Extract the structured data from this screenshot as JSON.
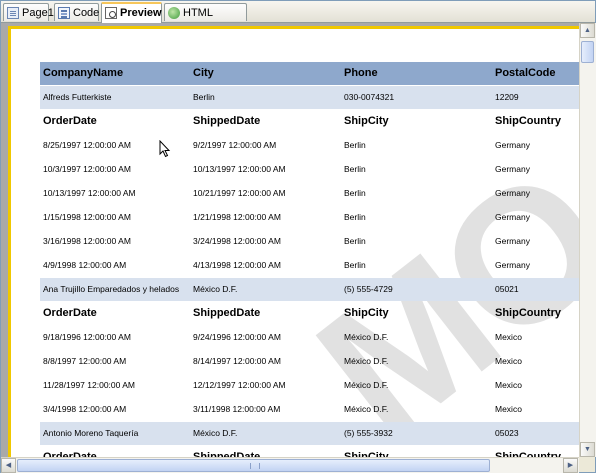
{
  "tabs": [
    {
      "label": "Page1",
      "icon": "page-icon"
    },
    {
      "label": "Code",
      "icon": "code-icon"
    },
    {
      "label": "Preview",
      "icon": "preview-icon",
      "active": true
    },
    {
      "label": "HTML Preview",
      "icon": "html-preview-icon"
    }
  ],
  "watermark": "MO",
  "header": {
    "c1": "CompanyName",
    "c2": "City",
    "c3": "Phone",
    "c4": "PostalCode"
  },
  "sub_header": {
    "c1": "OrderDate",
    "c2": "ShippedDate",
    "c3": "ShipCity",
    "c4": "ShipCountry"
  },
  "groups": [
    {
      "company": {
        "c1": "Alfreds Futterkiste",
        "c2": "Berlin",
        "c3": "030-0074321",
        "c4": "12209"
      },
      "orders": [
        {
          "c1": "8/25/1997 12:00:00 AM",
          "c2": "9/2/1997 12:00:00 AM",
          "c3": "Berlin",
          "c4": "Germany"
        },
        {
          "c1": "10/3/1997 12:00:00 AM",
          "c2": "10/13/1997 12:00:00 AM",
          "c3": "Berlin",
          "c4": "Germany"
        },
        {
          "c1": "10/13/1997 12:00:00 AM",
          "c2": "10/21/1997 12:00:00 AM",
          "c3": "Berlin",
          "c4": "Germany"
        },
        {
          "c1": "1/15/1998 12:00:00 AM",
          "c2": "1/21/1998 12:00:00 AM",
          "c3": "Berlin",
          "c4": "Germany"
        },
        {
          "c1": "3/16/1998 12:00:00 AM",
          "c2": "3/24/1998 12:00:00 AM",
          "c3": "Berlin",
          "c4": "Germany"
        },
        {
          "c1": "4/9/1998 12:00:00 AM",
          "c2": "4/13/1998 12:00:00 AM",
          "c3": "Berlin",
          "c4": "Germany"
        }
      ]
    },
    {
      "company": {
        "c1": "Ana Trujillo Emparedados y helados",
        "c2": "México D.F.",
        "c3": "(5) 555-4729",
        "c4": "05021"
      },
      "orders": [
        {
          "c1": "9/18/1996 12:00:00 AM",
          "c2": "9/24/1996 12:00:00 AM",
          "c3": "México D.F.",
          "c4": "Mexico"
        },
        {
          "c1": "8/8/1997 12:00:00 AM",
          "c2": "8/14/1997 12:00:00 AM",
          "c3": "México D.F.",
          "c4": "Mexico"
        },
        {
          "c1": "11/28/1997 12:00:00 AM",
          "c2": "12/12/1997 12:00:00 AM",
          "c3": "México D.F.",
          "c4": "Mexico"
        },
        {
          "c1": "3/4/1998 12:00:00 AM",
          "c2": "3/11/1998 12:00:00 AM",
          "c3": "México D.F.",
          "c4": "Mexico"
        }
      ]
    },
    {
      "company": {
        "c1": "Antonio Moreno Taquería",
        "c2": "México D.F.",
        "c3": "(5) 555-3932",
        "c4": "05023"
      },
      "orders": []
    }
  ],
  "colors": {
    "header_bg": "#8ea8cc",
    "band_bg": "#d8e1ee",
    "page_border": "#f0c800"
  }
}
